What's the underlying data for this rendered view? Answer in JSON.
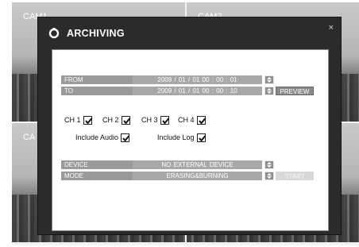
{
  "cameras": [
    "CAM1",
    "CAM2",
    "CA",
    ""
  ],
  "dialog": {
    "title": "ARCHIVING",
    "close_glyph": "×"
  },
  "from": {
    "label": "FROM",
    "value": "2009 / 01 / 01    00 : 00 : 01"
  },
  "to": {
    "label": "TO",
    "value": "2009 / 01 / 01    00 : 00 : 10",
    "preview_label": "PREVIEW"
  },
  "channels": [
    {
      "label": "CH 1",
      "checked": true
    },
    {
      "label": "CH 2",
      "checked": true
    },
    {
      "label": "CH 3",
      "checked": true
    },
    {
      "label": "CH 4",
      "checked": true
    }
  ],
  "options": {
    "include_audio": {
      "label": "Include Audio",
      "checked": true
    },
    "include_log": {
      "label": "Include Log",
      "checked": true
    }
  },
  "device": {
    "label": "DEVICE",
    "value": "NO EXTERNAL DEVICE"
  },
  "mode": {
    "label": "MODE",
    "value": "ERASING&BURNING",
    "start_label": "START"
  },
  "colors": {
    "dialog_bg": "#2b2b2b",
    "field_bg": "#a8a8a8",
    "label_bg": "#9a9a9a"
  }
}
